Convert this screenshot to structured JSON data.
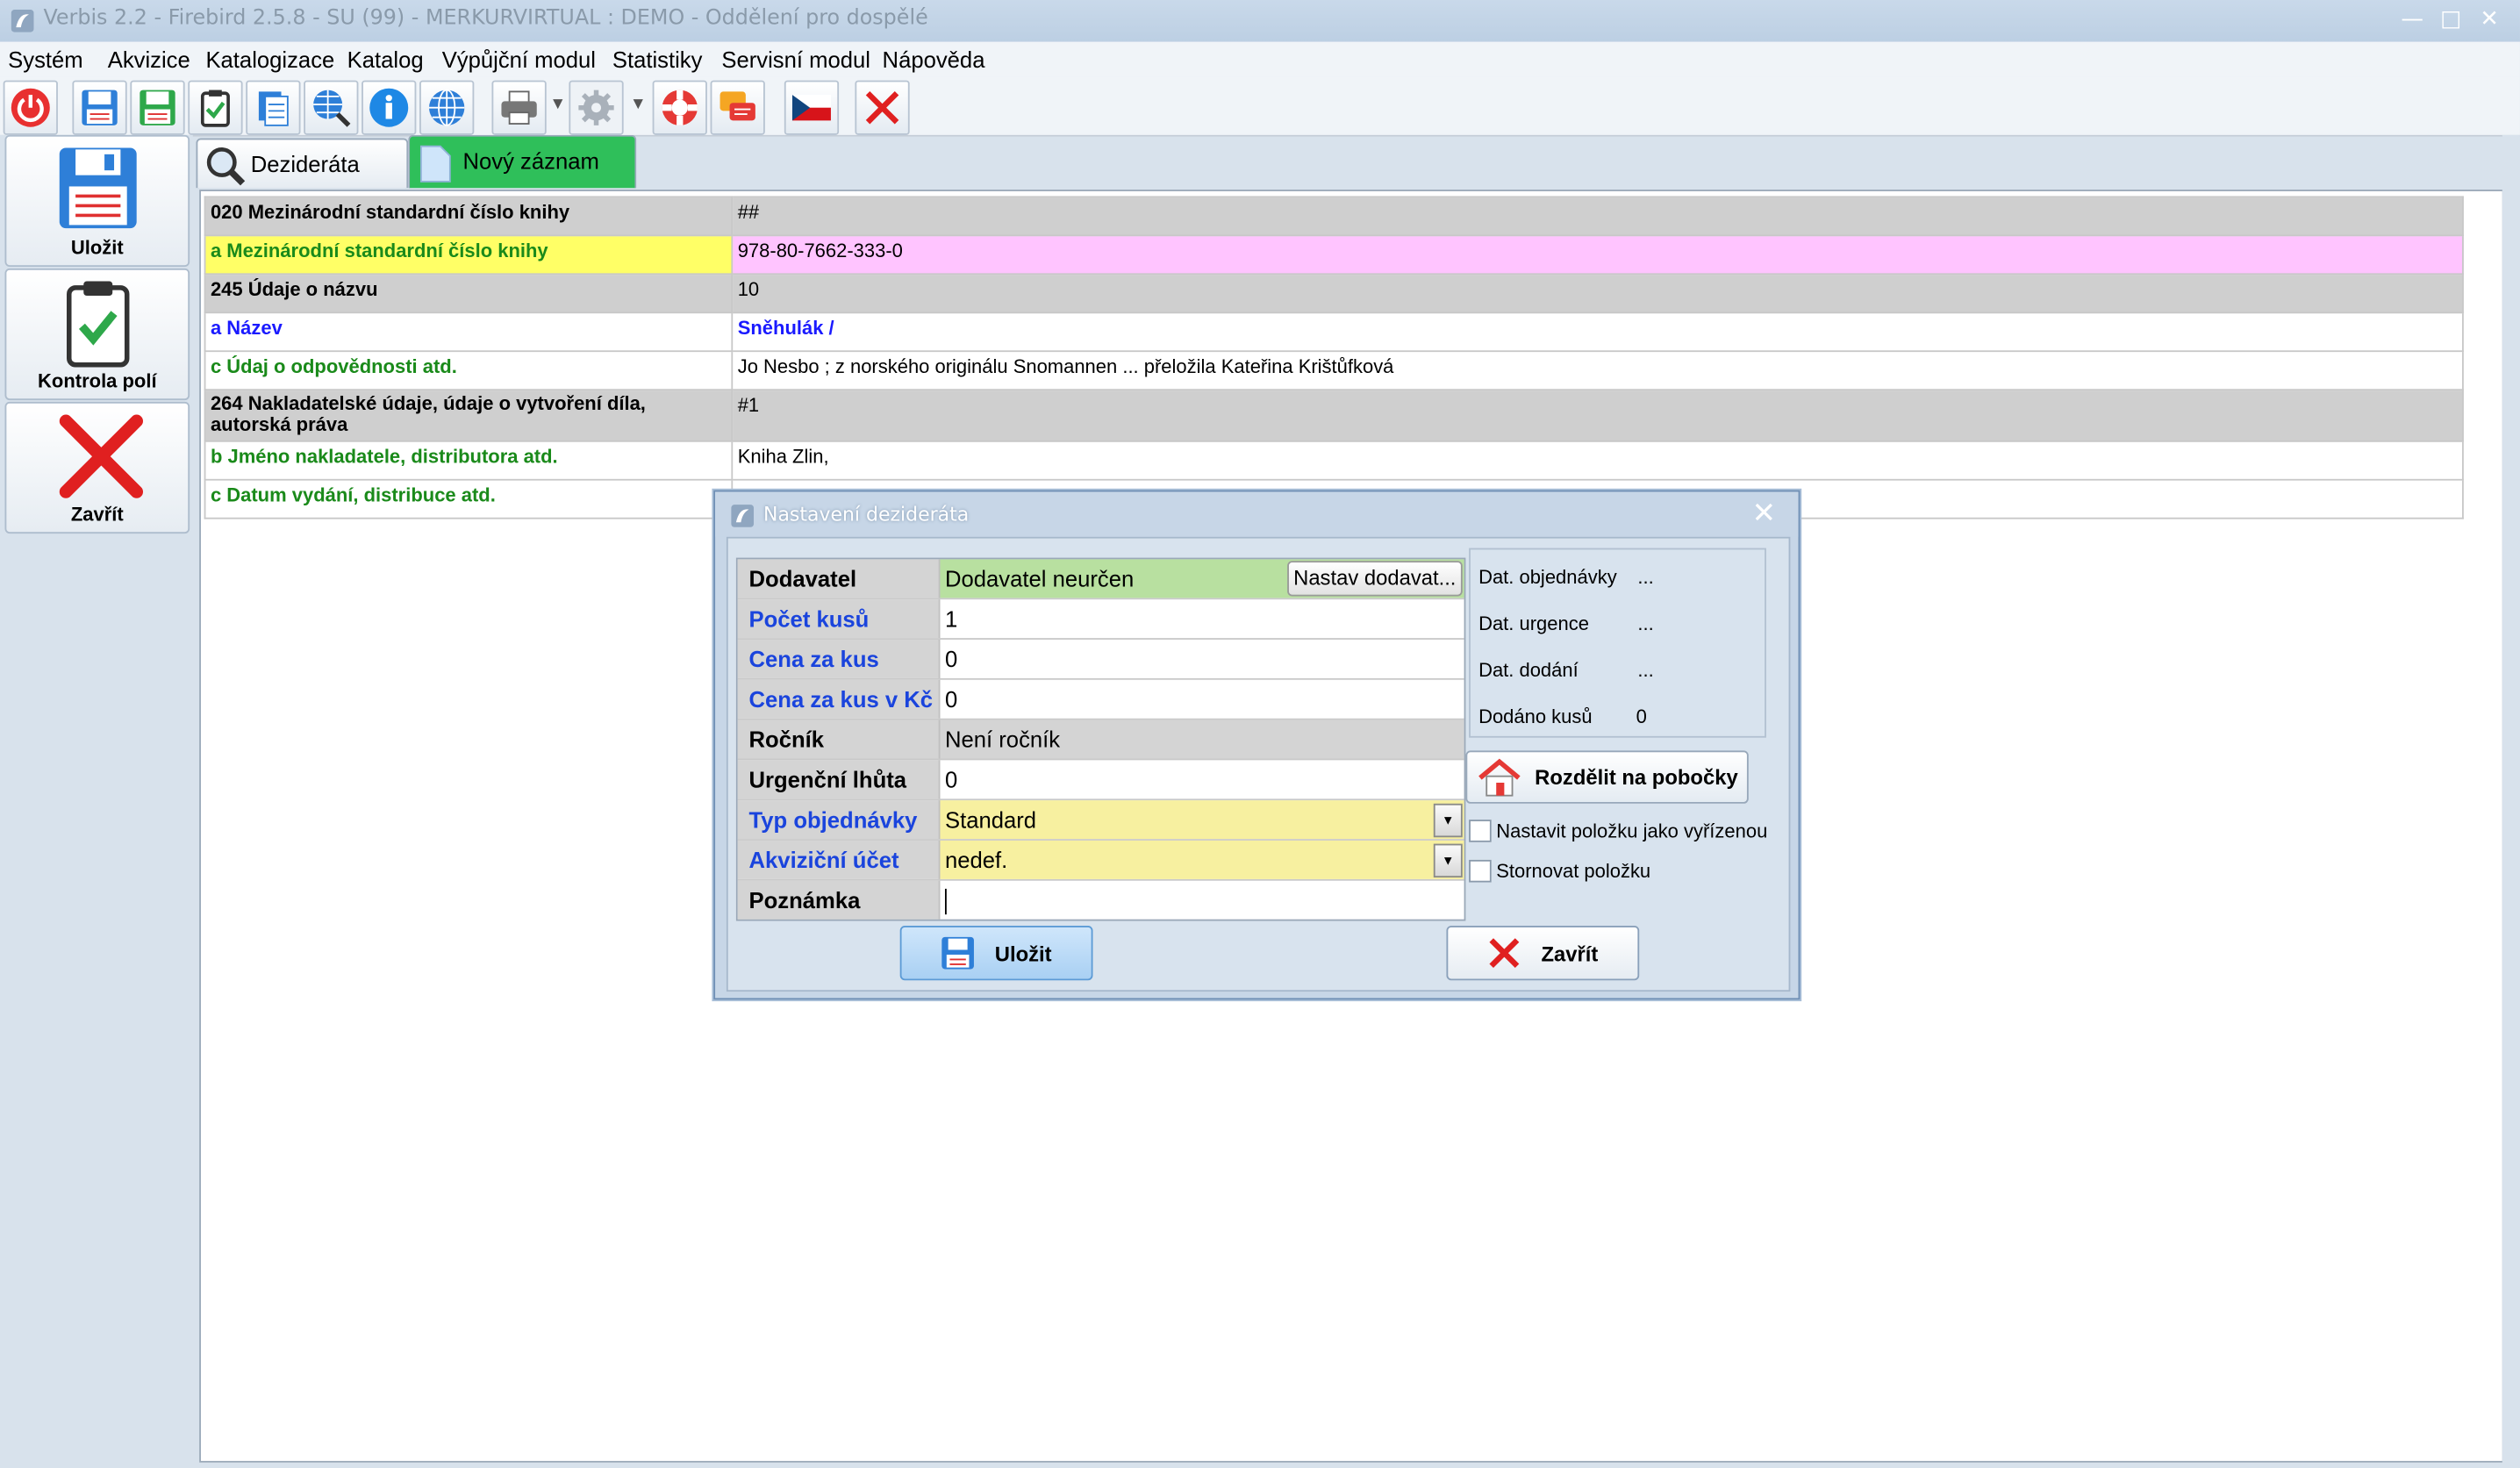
{
  "window": {
    "title": "Verbis 2.2 - Firebird 2.5.8 - SU (99) - MERKURVIRTUAL : DEMO - Oddělení pro dospělé"
  },
  "menu": [
    "Systém",
    "Akvizice",
    "Katalogizace",
    "Katalog",
    "Výpůjční modul",
    "Statistiky",
    "Servisní modul",
    "Nápověda"
  ],
  "toolbar_icons": [
    "power-icon",
    "save-icon",
    "save-green-icon",
    "clipboard-check-icon",
    "documents-icon",
    "globe-search-icon",
    "info-icon",
    "globe-icon",
    "printer-icon",
    "gear-icon",
    "lifebuoy-icon",
    "chat-icon",
    "czech-flag-icon",
    "close-icon"
  ],
  "sidebar": {
    "save_label": "Uložit",
    "check_label": "Kontrola polí",
    "close_label": "Zavřít"
  },
  "tabs": {
    "deziderata": "Dezideráta",
    "new_record": "Nový záznam"
  },
  "marc_rows": [
    {
      "label": "020 Mezinárodní standardní číslo knihy",
      "value": "##",
      "kind": "tag"
    },
    {
      "label": "a Mezinárodní standardní číslo knihy",
      "value": "978-80-7662-333-0",
      "kind": "sub-hl"
    },
    {
      "label": "245 Údaje o názvu",
      "value": "10",
      "kind": "tag"
    },
    {
      "label": "a Název",
      "value": "Sněhulák /",
      "kind": "sub-blue"
    },
    {
      "label": "c Údaj o odpovědnosti atd.",
      "value": "Jo Nesbo ; z norského originálu Snomannen ... přeložila Kateřina Krištůfková",
      "kind": "sub"
    },
    {
      "label": "264 Nakladatelské údaje, údaje o vytvoření díla, autorská práva",
      "value": "#1",
      "kind": "tag"
    },
    {
      "label": "b Jméno nakladatele, distributora atd.",
      "value": "Kniha Zlin,",
      "kind": "sub"
    },
    {
      "label": "c Datum vydání, distribuce atd.",
      "value": "",
      "kind": "sub"
    }
  ],
  "dialog": {
    "title": "Nastavení dezideráta",
    "fields": {
      "dodavatel_label": "Dodavatel",
      "dodavatel_value": "Dodavatel neurčen",
      "nastav_button": "Nastav dodavat...",
      "pocet_label": "Počet kusů",
      "pocet_value": "1",
      "cena_label": "Cena za kus",
      "cena_value": "0",
      "cena_kc_label": "Cena za kus v Kč",
      "cena_kc_value": "0",
      "rocnik_label": "Ročník",
      "rocnik_value": "Není ročník",
      "urgencni_label": "Urgenční lhůta",
      "urgencni_value": "0",
      "typ_label": "Typ objednávky",
      "typ_value": "Standard",
      "ucet_label": "Akviziční účet",
      "ucet_value": "nedef.",
      "poznamka_label": "Poznámka",
      "poznamka_value": ""
    },
    "info": {
      "dat_obj_label": "Dat. objednávky",
      "dat_obj_value": "...",
      "dat_urg_label": "Dat. urgence",
      "dat_urg_value": "...",
      "dat_dod_label": "Dat. dodání",
      "dat_dod_value": "...",
      "dodano_label": "Dodáno kusů",
      "dodano_value": "0"
    },
    "split_button": "Rozdělit na pobočky",
    "check_resolved": "Nastavit položku jako vyřízenou",
    "check_cancel": "Stornovat položku",
    "save_button": "Uložit",
    "close_button": "Zavřít"
  },
  "colors": {
    "subfield_green": "#1a8a1a",
    "highlight_yellow": "#ffff66",
    "highlight_pink": "#ffc4ff",
    "supplier_green": "#b8e0a0",
    "combo_yellow": "#f7f0a0",
    "label_blue": "#1a44dd",
    "close_red": "#e02020"
  }
}
